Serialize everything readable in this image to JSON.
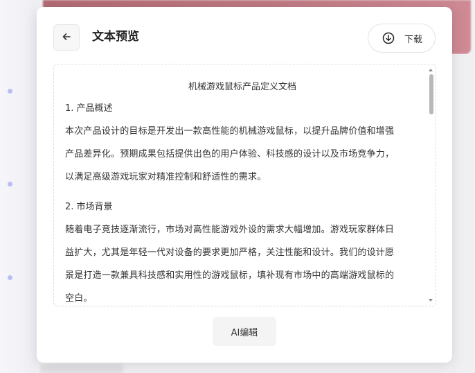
{
  "header": {
    "title": "文本预览",
    "download_label": "下载"
  },
  "document": {
    "title": "机械游戏鼠标产品定义文档",
    "sections": [
      {
        "heading": "1. 产品概述",
        "lines": [
          "本次产品设计的目标是开发出一款高性能的机械游戏鼠标，以提升品牌价值和增强",
          "产品差异化。预期成果包括提供出色的用户体验、科技感的设计以及市场竞争力，",
          "以满足高级游戏玩家对精准控制和舒适性的需求。"
        ]
      },
      {
        "heading": "2. 市场背景",
        "lines": [
          "随着电子竞技逐渐流行，市场对高性能游戏外设的需求大幅增加。游戏玩家群体日",
          "益扩大，尤其是年轻一代对设备的要求更加严格，关注性能和设计。我们的设计愿",
          "景是打造一款兼具科技感和实用性的游戏鼠标，填补现有市场中的高端游戏鼠标的",
          "空白。"
        ]
      }
    ]
  },
  "footer": {
    "ai_edit_label": "AI编辑"
  },
  "icons": {
    "back": "arrow-left-icon",
    "download": "download-circle-icon"
  }
}
